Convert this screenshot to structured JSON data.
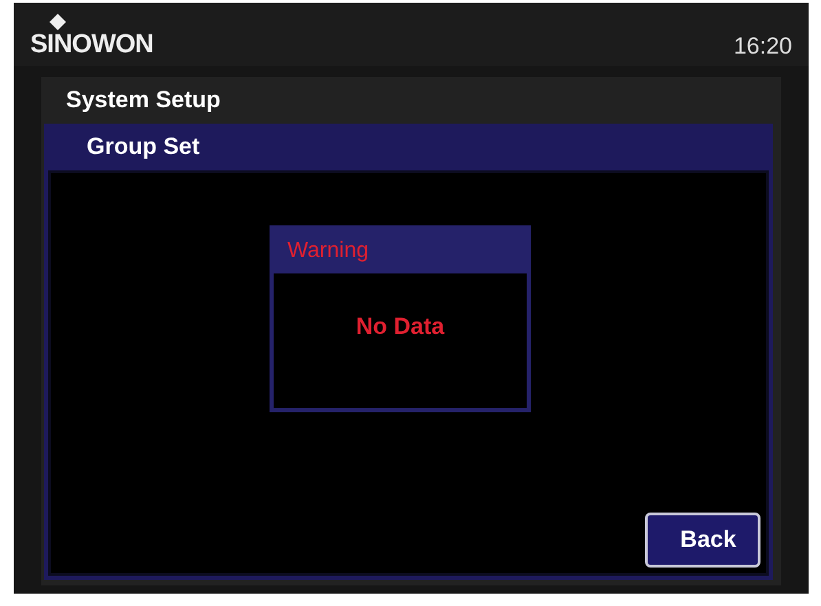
{
  "header": {
    "logo": "SINOWON",
    "time": "16:20"
  },
  "panel": {
    "title": "System Setup"
  },
  "section": {
    "title": "Group Set"
  },
  "dialog": {
    "title": "Warning",
    "message": "No Data"
  },
  "buttons": [
    {
      "label": "Back"
    }
  ]
}
